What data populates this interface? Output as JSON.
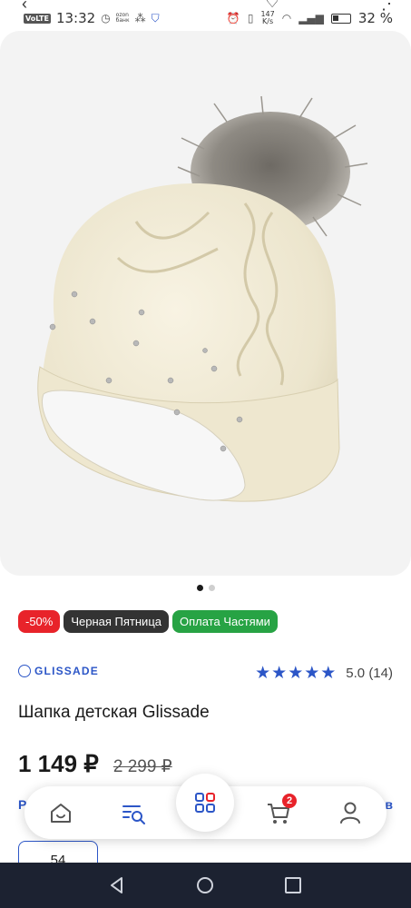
{
  "status_bar": {
    "network": "VoLTE",
    "time": "13:32",
    "ozon_line1": "ozon",
    "ozon_line2": "банк",
    "speed_value": "147",
    "speed_unit": "K/s",
    "battery": "32 %"
  },
  "gallery": {
    "slides_total": 2,
    "active_slide": 1
  },
  "badges": {
    "discount": "-50%",
    "black_friday": "Черная Пятница",
    "installments": "Оплата Частями"
  },
  "brand": {
    "name": "GLISSADE"
  },
  "rating": {
    "stars": "★★★★★",
    "text": "5.0 (14)",
    "value": 5.0
  },
  "product": {
    "title": "Шапка детская Glissade",
    "price": "1 149 ₽",
    "old_price": "2 299 ₽"
  },
  "partial": {
    "left": "Р",
    "right": "в"
  },
  "size": {
    "selected": "54"
  },
  "bottom_nav": {
    "cart_count": "2"
  },
  "colors": {
    "accent": "#2c56c7",
    "discount": "#e8232a",
    "black_friday": "#333333",
    "installments": "#27a344"
  }
}
